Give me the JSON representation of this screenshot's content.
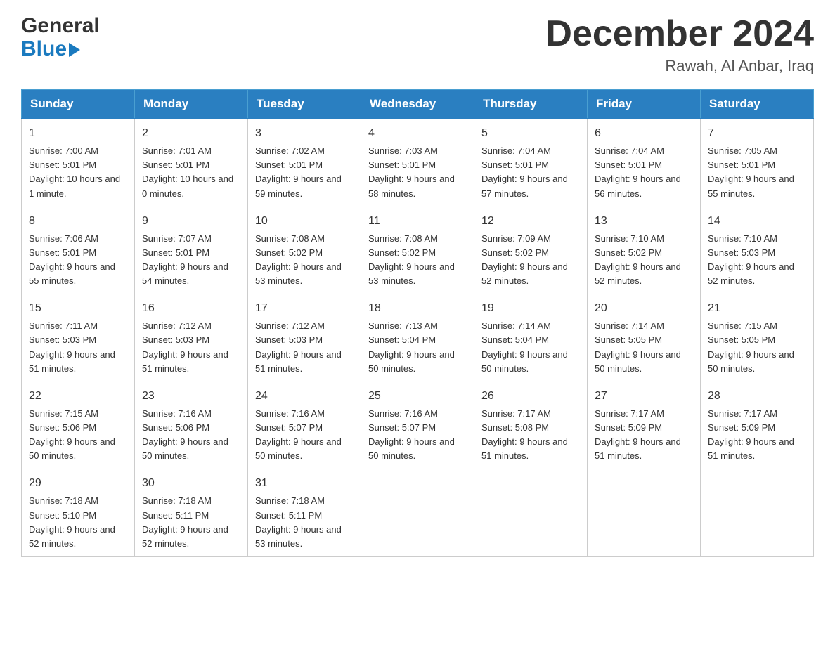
{
  "header": {
    "logo_line1": "General",
    "logo_line2": "Blue",
    "month_title": "December 2024",
    "location": "Rawah, Al Anbar, Iraq"
  },
  "calendar": {
    "days_of_week": [
      "Sunday",
      "Monday",
      "Tuesday",
      "Wednesday",
      "Thursday",
      "Friday",
      "Saturday"
    ],
    "weeks": [
      [
        {
          "day": "1",
          "sunrise": "7:00 AM",
          "sunset": "5:01 PM",
          "daylight": "10 hours and 1 minute."
        },
        {
          "day": "2",
          "sunrise": "7:01 AM",
          "sunset": "5:01 PM",
          "daylight": "10 hours and 0 minutes."
        },
        {
          "day": "3",
          "sunrise": "7:02 AM",
          "sunset": "5:01 PM",
          "daylight": "9 hours and 59 minutes."
        },
        {
          "day": "4",
          "sunrise": "7:03 AM",
          "sunset": "5:01 PM",
          "daylight": "9 hours and 58 minutes."
        },
        {
          "day": "5",
          "sunrise": "7:04 AM",
          "sunset": "5:01 PM",
          "daylight": "9 hours and 57 minutes."
        },
        {
          "day": "6",
          "sunrise": "7:04 AM",
          "sunset": "5:01 PM",
          "daylight": "9 hours and 56 minutes."
        },
        {
          "day": "7",
          "sunrise": "7:05 AM",
          "sunset": "5:01 PM",
          "daylight": "9 hours and 55 minutes."
        }
      ],
      [
        {
          "day": "8",
          "sunrise": "7:06 AM",
          "sunset": "5:01 PM",
          "daylight": "9 hours and 55 minutes."
        },
        {
          "day": "9",
          "sunrise": "7:07 AM",
          "sunset": "5:01 PM",
          "daylight": "9 hours and 54 minutes."
        },
        {
          "day": "10",
          "sunrise": "7:08 AM",
          "sunset": "5:02 PM",
          "daylight": "9 hours and 53 minutes."
        },
        {
          "day": "11",
          "sunrise": "7:08 AM",
          "sunset": "5:02 PM",
          "daylight": "9 hours and 53 minutes."
        },
        {
          "day": "12",
          "sunrise": "7:09 AM",
          "sunset": "5:02 PM",
          "daylight": "9 hours and 52 minutes."
        },
        {
          "day": "13",
          "sunrise": "7:10 AM",
          "sunset": "5:02 PM",
          "daylight": "9 hours and 52 minutes."
        },
        {
          "day": "14",
          "sunrise": "7:10 AM",
          "sunset": "5:03 PM",
          "daylight": "9 hours and 52 minutes."
        }
      ],
      [
        {
          "day": "15",
          "sunrise": "7:11 AM",
          "sunset": "5:03 PM",
          "daylight": "9 hours and 51 minutes."
        },
        {
          "day": "16",
          "sunrise": "7:12 AM",
          "sunset": "5:03 PM",
          "daylight": "9 hours and 51 minutes."
        },
        {
          "day": "17",
          "sunrise": "7:12 AM",
          "sunset": "5:03 PM",
          "daylight": "9 hours and 51 minutes."
        },
        {
          "day": "18",
          "sunrise": "7:13 AM",
          "sunset": "5:04 PM",
          "daylight": "9 hours and 50 minutes."
        },
        {
          "day": "19",
          "sunrise": "7:14 AM",
          "sunset": "5:04 PM",
          "daylight": "9 hours and 50 minutes."
        },
        {
          "day": "20",
          "sunrise": "7:14 AM",
          "sunset": "5:05 PM",
          "daylight": "9 hours and 50 minutes."
        },
        {
          "day": "21",
          "sunrise": "7:15 AM",
          "sunset": "5:05 PM",
          "daylight": "9 hours and 50 minutes."
        }
      ],
      [
        {
          "day": "22",
          "sunrise": "7:15 AM",
          "sunset": "5:06 PM",
          "daylight": "9 hours and 50 minutes."
        },
        {
          "day": "23",
          "sunrise": "7:16 AM",
          "sunset": "5:06 PM",
          "daylight": "9 hours and 50 minutes."
        },
        {
          "day": "24",
          "sunrise": "7:16 AM",
          "sunset": "5:07 PM",
          "daylight": "9 hours and 50 minutes."
        },
        {
          "day": "25",
          "sunrise": "7:16 AM",
          "sunset": "5:07 PM",
          "daylight": "9 hours and 50 minutes."
        },
        {
          "day": "26",
          "sunrise": "7:17 AM",
          "sunset": "5:08 PM",
          "daylight": "9 hours and 51 minutes."
        },
        {
          "day": "27",
          "sunrise": "7:17 AM",
          "sunset": "5:09 PM",
          "daylight": "9 hours and 51 minutes."
        },
        {
          "day": "28",
          "sunrise": "7:17 AM",
          "sunset": "5:09 PM",
          "daylight": "9 hours and 51 minutes."
        }
      ],
      [
        {
          "day": "29",
          "sunrise": "7:18 AM",
          "sunset": "5:10 PM",
          "daylight": "9 hours and 52 minutes."
        },
        {
          "day": "30",
          "sunrise": "7:18 AM",
          "sunset": "5:11 PM",
          "daylight": "9 hours and 52 minutes."
        },
        {
          "day": "31",
          "sunrise": "7:18 AM",
          "sunset": "5:11 PM",
          "daylight": "9 hours and 53 minutes."
        },
        null,
        null,
        null,
        null
      ]
    ]
  }
}
